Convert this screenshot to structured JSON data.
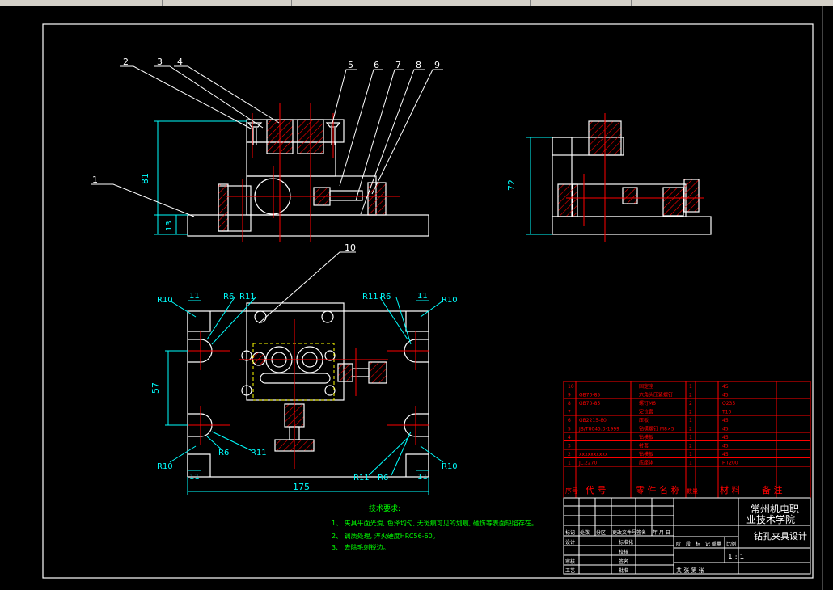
{
  "balloons": [
    "1",
    "2",
    "3",
    "4",
    "5",
    "6",
    "7",
    "8",
    "9",
    "10"
  ],
  "dims": {
    "h81": "81",
    "h13": "13",
    "h72": "72",
    "h57": "57",
    "w175": "175",
    "d11": "11",
    "r10": "R10",
    "r6": "R6",
    "r11": "R11"
  },
  "notes": {
    "title": "技术要求:",
    "line1": "1、 夹具平面光滑, 色泽均匀, 无斑痕可见的划痕, 碰伤等表面缺陷存在。",
    "line2": "2、 调质处理, 淬火硬度HRC56-60。",
    "line3": "3、 去除毛刺锐边。"
  },
  "bom": {
    "rows": [
      {
        "no": "10",
        "code": "",
        "name": "固定座",
        "qty": "1",
        "mat": "45"
      },
      {
        "no": "9",
        "code": "GB70-85",
        "name": "六角头压紧螺钉",
        "qty": "2",
        "mat": "45"
      },
      {
        "no": "8",
        "code": "GB70-85",
        "name": "螺钉M6",
        "qty": "2",
        "mat": "Q235"
      },
      {
        "no": "7",
        "code": "",
        "name": "定位套",
        "qty": "2",
        "mat": "T10"
      },
      {
        "no": "6",
        "code": "GB2215-80",
        "name": "压板",
        "qty": "1",
        "mat": "45"
      },
      {
        "no": "5",
        "code": "JB/T8045.3-1999",
        "name": "钻模螺钉 M8×5",
        "qty": "2",
        "mat": "45"
      },
      {
        "no": "4",
        "code": "",
        "name": "钻模板",
        "qty": "1",
        "mat": "45"
      },
      {
        "no": "3",
        "code": "",
        "name": "衬套",
        "qty": "2",
        "mat": "45"
      },
      {
        "no": "2",
        "code": "xxxxxxxxxx",
        "name": "钻模板",
        "qty": "1",
        "mat": "45"
      },
      {
        "no": "1",
        "code": "JL.2270",
        "name": "底座体",
        "qty": "1",
        "mat": "HT200"
      }
    ],
    "header": {
      "no": "序号",
      "code": "代  号",
      "name": "零 件 名 称",
      "qty": "数量",
      "mat": "材  料",
      "remark": "备  注"
    }
  },
  "titleblock": {
    "school": [
      "常州机电职",
      "业技术学院"
    ],
    "drawing": "钻孔夹具设计",
    "scale": "1 : 1",
    "sheet": "共    张  第    张",
    "labels": [
      "标记",
      "处数",
      "分区",
      "更改文件号",
      "签名",
      "年 月 日"
    ],
    "roles": [
      "设计",
      "标准化",
      "校核",
      "审核",
      "工艺",
      "批准"
    ],
    "stage": [
      "阶",
      "段",
      "标",
      "记",
      "重量",
      "比例"
    ],
    "role_sign": "签名"
  },
  "colors": {
    "bg": "#000000",
    "outline": "#ffffff",
    "dim": "#00ffff",
    "center": "#ff0000",
    "hatch": "#ff0000",
    "note": "#00ff00",
    "table": "#ff0000",
    "hidden": "#ffff00"
  }
}
